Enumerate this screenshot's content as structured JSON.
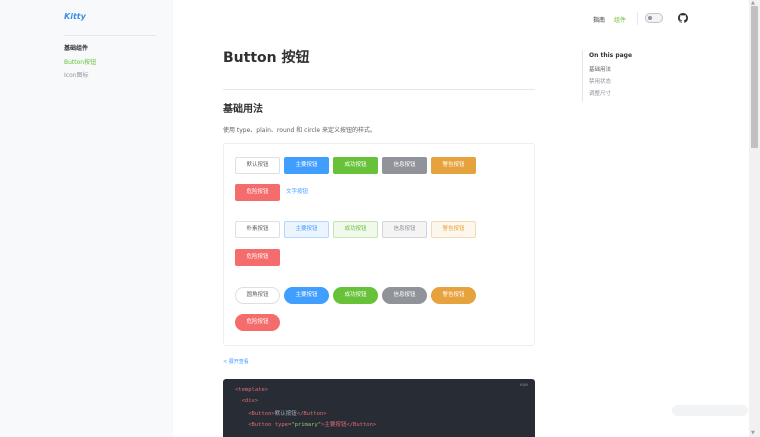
{
  "brand": {
    "logo": "Kitty"
  },
  "sidebar": {
    "group": "基础组件",
    "items": [
      {
        "label": "Button按钮",
        "active": true
      },
      {
        "label": "Icon图标",
        "active": false
      }
    ]
  },
  "nav": {
    "links": [
      "指南",
      "组件"
    ],
    "theme_toggle_icon": "moon-icon",
    "github_icon": "github-icon"
  },
  "main": {
    "title": "Button 按钮",
    "section": {
      "title": "基础用法",
      "desc": "使用 type、plain、round 和 circle 来定义按钮的样式。"
    },
    "rows": [
      {
        "variant": "default",
        "buttons": [
          "默认按钮",
          "主要按钮",
          "成功按钮",
          "信息按钮",
          "警告按钮",
          "危险按钮",
          "文字按钮"
        ]
      },
      {
        "variant": "plain",
        "buttons": [
          "朴素按钮",
          "主要按钮",
          "成功按钮",
          "信息按钮",
          "警告按钮",
          "危险按钮"
        ]
      },
      {
        "variant": "round",
        "buttons": [
          "圆角按钮",
          "主要按钮",
          "成功按钮",
          "信息按钮",
          "警告按钮",
          "危险按钮"
        ]
      }
    ],
    "expand_label": "< 展开查看",
    "code": {
      "lang": "vue",
      "lines": [
        [
          "<template>"
        ],
        [
          "  <div>"
        ],
        [
          "    <Button>",
          "默认按钮",
          "</Button>"
        ],
        [
          "    <Button type=",
          "\"primary\"",
          ">主要按钮</Button>"
        ]
      ]
    }
  },
  "toc": {
    "title": "On this page",
    "items": [
      "基础用法",
      "禁用状态",
      "调整尺寸"
    ]
  },
  "colors": {
    "primary": "#409eff",
    "success": "#67c23a",
    "info": "#909399",
    "warning": "#e6a23c",
    "danger": "#f56c6c"
  }
}
